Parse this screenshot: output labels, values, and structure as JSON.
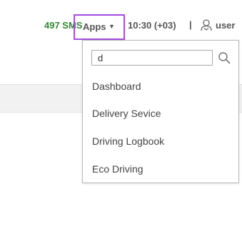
{
  "header": {
    "sms_label": "497 SMS",
    "apps_label": "Apps",
    "clock": "10:30 (+03)",
    "separator": "|",
    "user_label": "user"
  },
  "apps_menu": {
    "search_value": "d",
    "items": [
      {
        "label": "Dashboard"
      },
      {
        "label": "Delivery Sevice"
      },
      {
        "label": "Driving Logbook"
      },
      {
        "label": "Eco Driving"
      }
    ]
  },
  "icons": {
    "caret": "caret-down-icon",
    "user": "user-icon",
    "search": "search-icon"
  },
  "colors": {
    "sms": "#2e8b2e",
    "apps_highlight": "#a64ce0",
    "text": "#555555"
  }
}
